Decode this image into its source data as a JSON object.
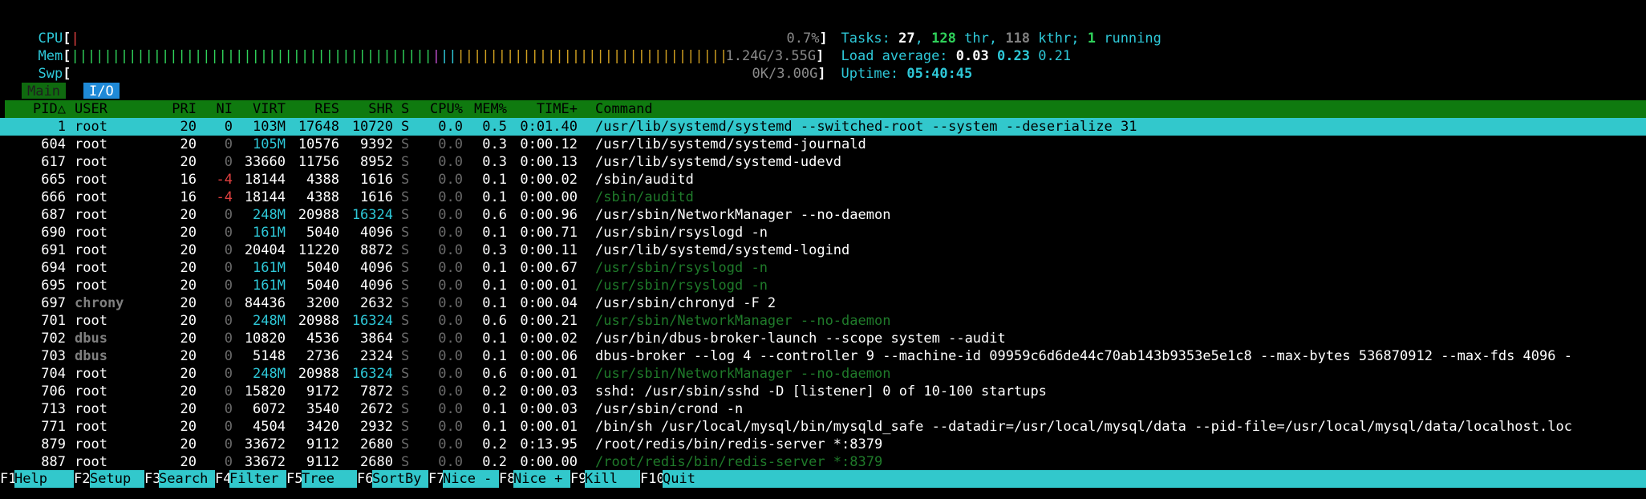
{
  "meters": {
    "cpu": {
      "label": "CPU",
      "value": "0.7%"
    },
    "mem": {
      "label": "Mem",
      "value": "1.24G/3.55G"
    },
    "swp": {
      "label": "Swp",
      "value": "0K/3.00G"
    }
  },
  "summary": {
    "tasks_label": "Tasks:",
    "tasks": "27",
    "thr": "128",
    "thr_label": "thr,",
    "kthr": "118",
    "kthr_label": "kthr;",
    "running": "1",
    "running_label": "running",
    "load_label": "Load average:",
    "load1": "0.03",
    "load5": "0.23",
    "load15": "0.21",
    "uptime_label": "Uptime:",
    "uptime": "05:40:45"
  },
  "tabs": [
    {
      "label": "Main"
    },
    {
      "label": "I/O"
    }
  ],
  "columns": {
    "pid": "PID△",
    "user": "USER",
    "pri": "PRI",
    "ni": "NI",
    "virt": "VIRT",
    "res": "RES",
    "shr": "SHR",
    "s": "S",
    "cpu": "CPU%",
    "mem": "MEM%",
    "time": "TIME+",
    "command": "Command"
  },
  "processes": [
    {
      "pid": "1",
      "user": "root",
      "pri": "20",
      "ni": "0",
      "virt": "103M",
      "res": "17648",
      "shr": "10720",
      "s": "S",
      "cpu": "0.0",
      "mem": "0.5",
      "time": "0:01.40",
      "command": "/usr/lib/systemd/systemd --switched-root --system --deserialize 31",
      "selected": true
    },
    {
      "pid": "604",
      "user": "root",
      "pri": "20",
      "ni": "0",
      "virt": "105M",
      "res": "10576",
      "shr": "9392",
      "s": "S",
      "cpu": "0.0",
      "mem": "0.3",
      "time": "0:00.12",
      "command": "/usr/lib/systemd/systemd-journald"
    },
    {
      "pid": "617",
      "user": "root",
      "pri": "20",
      "ni": "0",
      "virt": "33660",
      "res": "11756",
      "shr": "8952",
      "s": "S",
      "cpu": "0.0",
      "mem": "0.3",
      "time": "0:00.13",
      "command": "/usr/lib/systemd/systemd-udevd"
    },
    {
      "pid": "665",
      "user": "root",
      "pri": "16",
      "ni": "-4",
      "virt": "18144",
      "res": "4388",
      "shr": "1616",
      "s": "S",
      "cpu": "0.0",
      "mem": "0.1",
      "time": "0:00.02",
      "command": "/sbin/auditd"
    },
    {
      "pid": "666",
      "user": "root",
      "pri": "16",
      "ni": "-4",
      "virt": "18144",
      "res": "4388",
      "shr": "1616",
      "s": "S",
      "cpu": "0.0",
      "mem": "0.1",
      "time": "0:00.00",
      "command": "/sbin/auditd",
      "thread": true
    },
    {
      "pid": "687",
      "user": "root",
      "pri": "20",
      "ni": "0",
      "virt": "248M",
      "res": "20988",
      "shr": "16324",
      "s": "S",
      "cpu": "0.0",
      "mem": "0.6",
      "time": "0:00.96",
      "command": "/usr/sbin/NetworkManager --no-daemon"
    },
    {
      "pid": "690",
      "user": "root",
      "pri": "20",
      "ni": "0",
      "virt": "161M",
      "res": "5040",
      "shr": "4096",
      "s": "S",
      "cpu": "0.0",
      "mem": "0.1",
      "time": "0:00.71",
      "command": "/usr/sbin/rsyslogd -n"
    },
    {
      "pid": "691",
      "user": "root",
      "pri": "20",
      "ni": "0",
      "virt": "20404",
      "res": "11220",
      "shr": "8872",
      "s": "S",
      "cpu": "0.0",
      "mem": "0.3",
      "time": "0:00.11",
      "command": "/usr/lib/systemd/systemd-logind"
    },
    {
      "pid": "694",
      "user": "root",
      "pri": "20",
      "ni": "0",
      "virt": "161M",
      "res": "5040",
      "shr": "4096",
      "s": "S",
      "cpu": "0.0",
      "mem": "0.1",
      "time": "0:00.67",
      "command": "/usr/sbin/rsyslogd -n",
      "thread": true
    },
    {
      "pid": "695",
      "user": "root",
      "pri": "20",
      "ni": "0",
      "virt": "161M",
      "res": "5040",
      "shr": "4096",
      "s": "S",
      "cpu": "0.0",
      "mem": "0.1",
      "time": "0:00.01",
      "command": "/usr/sbin/rsyslogd -n",
      "thread": true
    },
    {
      "pid": "697",
      "user": "chrony",
      "pri": "20",
      "ni": "0",
      "virt": "84436",
      "res": "3200",
      "shr": "2632",
      "s": "S",
      "cpu": "0.0",
      "mem": "0.1",
      "time": "0:00.04",
      "command": "/usr/sbin/chronyd -F 2"
    },
    {
      "pid": "701",
      "user": "root",
      "pri": "20",
      "ni": "0",
      "virt": "248M",
      "res": "20988",
      "shr": "16324",
      "s": "S",
      "cpu": "0.0",
      "mem": "0.6",
      "time": "0:00.21",
      "command": "/usr/sbin/NetworkManager --no-daemon",
      "thread": true
    },
    {
      "pid": "702",
      "user": "dbus",
      "pri": "20",
      "ni": "0",
      "virt": "10820",
      "res": "4536",
      "shr": "3864",
      "s": "S",
      "cpu": "0.0",
      "mem": "0.1",
      "time": "0:00.02",
      "command": "/usr/bin/dbus-broker-launch --scope system --audit"
    },
    {
      "pid": "703",
      "user": "dbus",
      "pri": "20",
      "ni": "0",
      "virt": "5148",
      "res": "2736",
      "shr": "2324",
      "s": "S",
      "cpu": "0.0",
      "mem": "0.1",
      "time": "0:00.06",
      "command": "dbus-broker --log 4 --controller 9 --machine-id 09959c6d6de44c70ab143b9353e5e1c8 --max-bytes 536870912 --max-fds 4096 -"
    },
    {
      "pid": "704",
      "user": "root",
      "pri": "20",
      "ni": "0",
      "virt": "248M",
      "res": "20988",
      "shr": "16324",
      "s": "S",
      "cpu": "0.0",
      "mem": "0.6",
      "time": "0:00.01",
      "command": "/usr/sbin/NetworkManager --no-daemon",
      "thread": true
    },
    {
      "pid": "706",
      "user": "root",
      "pri": "20",
      "ni": "0",
      "virt": "15820",
      "res": "9172",
      "shr": "7872",
      "s": "S",
      "cpu": "0.0",
      "mem": "0.2",
      "time": "0:00.03",
      "command": "sshd: /usr/sbin/sshd -D [listener] 0 of 10-100 startups"
    },
    {
      "pid": "713",
      "user": "root",
      "pri": "20",
      "ni": "0",
      "virt": "6072",
      "res": "3540",
      "shr": "2672",
      "s": "S",
      "cpu": "0.0",
      "mem": "0.1",
      "time": "0:00.03",
      "command": "/usr/sbin/crond -n"
    },
    {
      "pid": "771",
      "user": "root",
      "pri": "20",
      "ni": "0",
      "virt": "4504",
      "res": "3420",
      "shr": "2932",
      "s": "S",
      "cpu": "0.0",
      "mem": "0.1",
      "time": "0:00.01",
      "command": "/bin/sh /usr/local/mysql/bin/mysqld_safe --datadir=/usr/local/mysql/data --pid-file=/usr/local/mysql/data/localhost.loc"
    },
    {
      "pid": "879",
      "user": "root",
      "pri": "20",
      "ni": "0",
      "virt": "33672",
      "res": "9112",
      "shr": "2680",
      "s": "S",
      "cpu": "0.0",
      "mem": "0.2",
      "time": "0:13.95",
      "command": "/root/redis/bin/redis-server *:8379"
    },
    {
      "pid": "887",
      "user": "root",
      "pri": "20",
      "ni": "0",
      "virt": "33672",
      "res": "9112",
      "shr": "2680",
      "s": "S",
      "cpu": "0.0",
      "mem": "0.2",
      "time": "0:00.00",
      "command": "/root/redis/bin/redis-server *:8379",
      "thread": true
    }
  ],
  "fkeys": [
    {
      "key": "F1",
      "label": "Help"
    },
    {
      "key": "F2",
      "label": "Setup"
    },
    {
      "key": "F3",
      "label": "Search"
    },
    {
      "key": "F4",
      "label": "Filter"
    },
    {
      "key": "F5",
      "label": "Tree"
    },
    {
      "key": "F6",
      "label": "SortBy"
    },
    {
      "key": "F7",
      "label": "Nice -"
    },
    {
      "key": "F8",
      "label": "Nice +"
    },
    {
      "key": "F9",
      "label": "Kill"
    },
    {
      "key": "F10",
      "label": "Quit"
    }
  ]
}
